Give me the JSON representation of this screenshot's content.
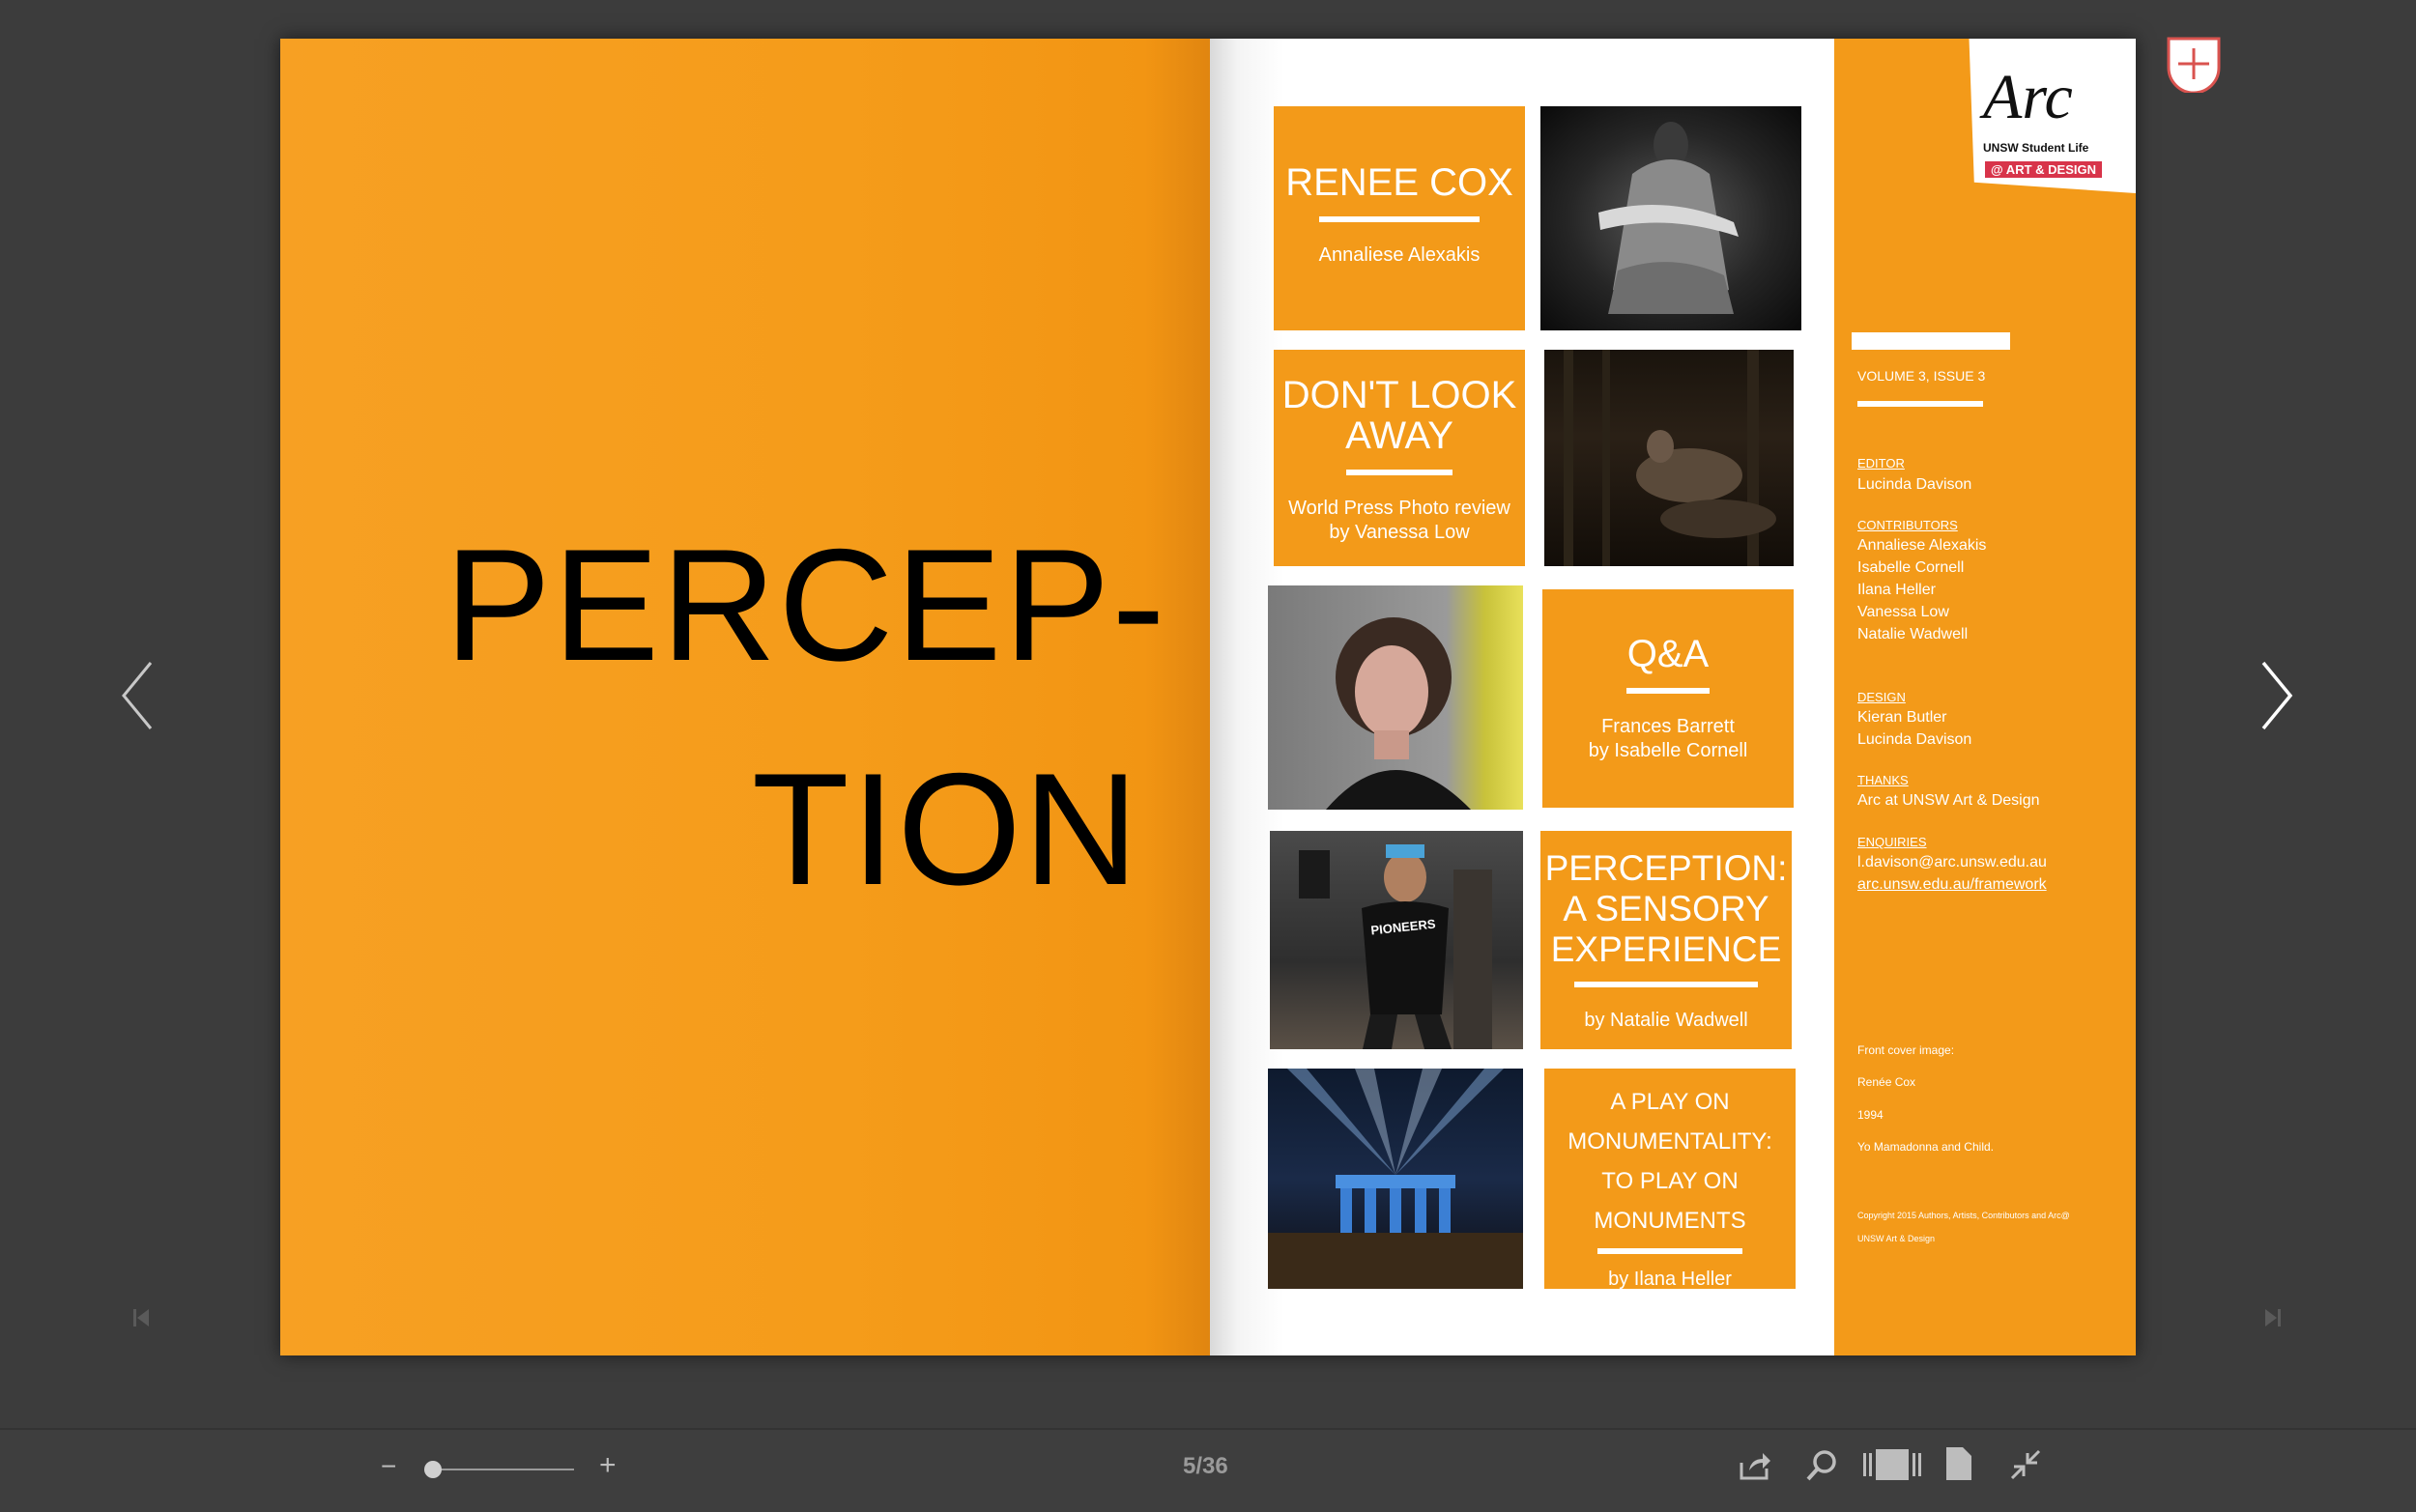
{
  "spread": {
    "left_page": {
      "title_line1": "PERCEP-",
      "title_line2": "TION"
    },
    "tiles": [
      {
        "heading": "RENEE COX",
        "subtitle": "Annaliese Alexakis"
      },
      {
        "heading_line1": "DON'T LOOK",
        "heading_line2": "AWAY",
        "subtitle_line1": "World Press Photo review",
        "subtitle_line2": "by Vanessa Low"
      },
      {
        "heading": "Q&A",
        "subtitle_line1": "Frances Barrett",
        "subtitle_line2": "by Isabelle Cornell"
      },
      {
        "heading_line1": "PERCEPTION:",
        "heading_line2": "A SENSORY",
        "heading_line3": "EXPERIENCE",
        "subtitle": "by Natalie Wadwell"
      },
      {
        "heading_line1": "A PLAY ON",
        "heading_line2": "MONUMENTALITY:",
        "heading_line3": "TO PLAY ON",
        "heading_line4": "MONUMENTS",
        "subtitle": "by Ilana Heller"
      }
    ],
    "photos": {
      "pieta": "pieta-photo",
      "dark_figures": "dark-figures-photo",
      "portrait": "portrait-photo",
      "performer": "performer-photo",
      "monument": "monument-photo"
    },
    "performer_shirt": "PIONEERS",
    "sidebar": {
      "logo_text": "Arc",
      "logo_sub": "UNSW Student Life",
      "logo_badge": "@ ART & DESIGN",
      "volume": "VOLUME 3, ISSUE 3",
      "editor_label": "EDITOR",
      "editor": "Lucinda Davison",
      "contributors_label": "CONTRIBUTORS",
      "contributors": [
        "Annaliese Alexakis",
        "Isabelle Cornell",
        "Ilana Heller",
        "Vanessa Low",
        "Natalie Wadwell"
      ],
      "design_label": "DESIGN",
      "design": [
        "Kieran Butler",
        "Lucinda Davison"
      ],
      "thanks_label": "THANKS",
      "thanks": "Arc at UNSW Art & Design",
      "enquiries_label": "ENQUIRIES",
      "email": "l.davison@arc.unsw.edu.au",
      "website": "arc.unsw.edu.au/framework",
      "cover_label": "Front cover image:",
      "cover_artist": "Renée Cox",
      "cover_year": "1994",
      "cover_title": "Yo Mamadonna and Child.",
      "copyright_line1": "Copyright 2015 Authors, Artists, Contributors and Arc@",
      "copyright_line2": "UNSW Art & Design"
    }
  },
  "toolbar": {
    "zoom_out": "−",
    "zoom_in": "+",
    "zoom_level": 0.05,
    "page_indicator": "5/36"
  },
  "colors": {
    "orange": "#f39a19",
    "background": "#3c3c3c",
    "toolbar": "#3e3e3e"
  }
}
